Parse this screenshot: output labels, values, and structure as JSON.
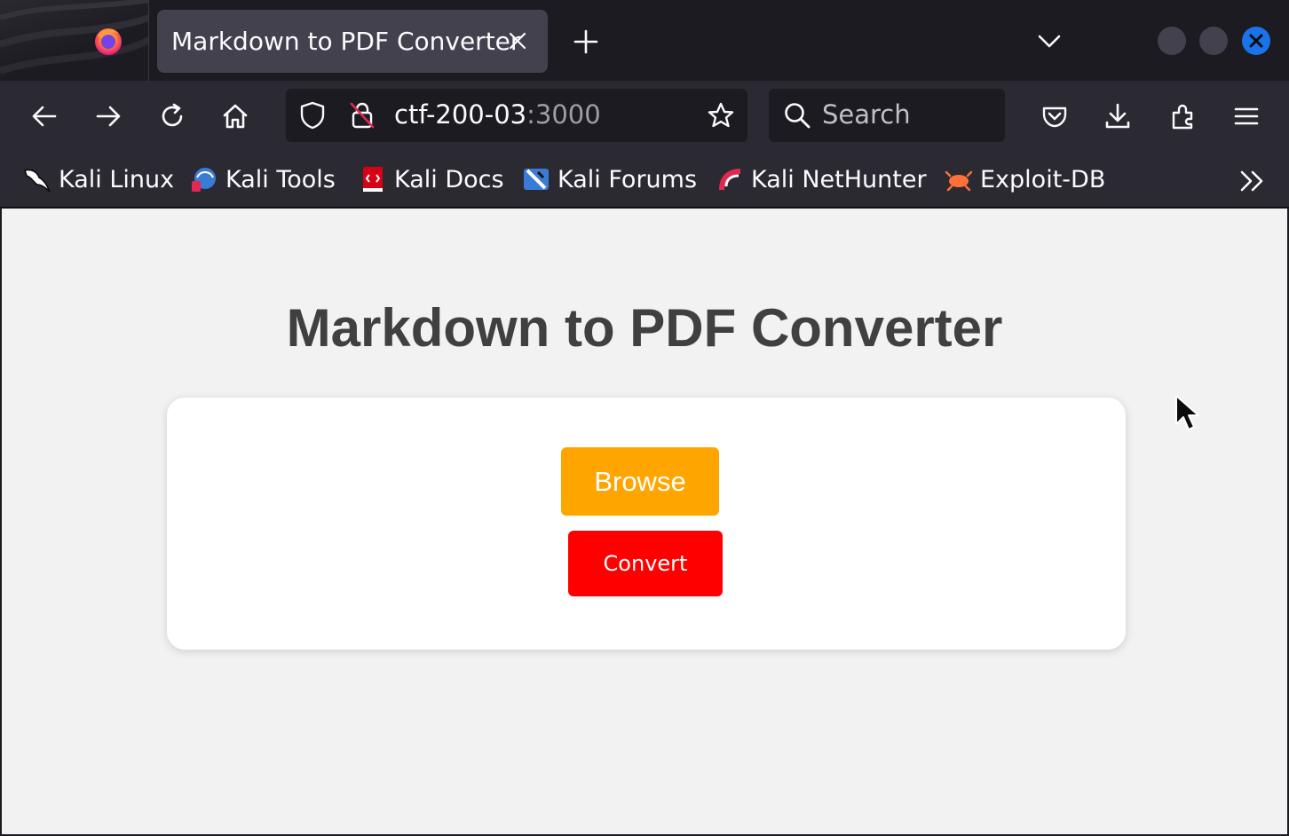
{
  "browser": {
    "tab": {
      "title": "Markdown to PDF Converter"
    },
    "url": {
      "host": "ctf-200-03",
      "port": ":3000"
    },
    "search": {
      "placeholder": "Search"
    },
    "bookmarks": [
      {
        "label": "Kali Linux",
        "icon": "kali-dragon-icon"
      },
      {
        "label": "Kali Tools",
        "icon": "kali-tools-icon"
      },
      {
        "label": "Kali Docs",
        "icon": "kali-docs-icon"
      },
      {
        "label": "Kali Forums",
        "icon": "kali-forums-icon"
      },
      {
        "label": "Kali NetHunter",
        "icon": "kali-nethunter-icon"
      },
      {
        "label": "Exploit-DB",
        "icon": "exploit-db-icon"
      }
    ]
  },
  "page": {
    "title": "Markdown to PDF Converter",
    "browse_label": "Browse",
    "convert_label": "Convert"
  },
  "colors": {
    "browse": "#ffa500",
    "convert": "#ff0000",
    "window_close": "#1a73e8"
  }
}
